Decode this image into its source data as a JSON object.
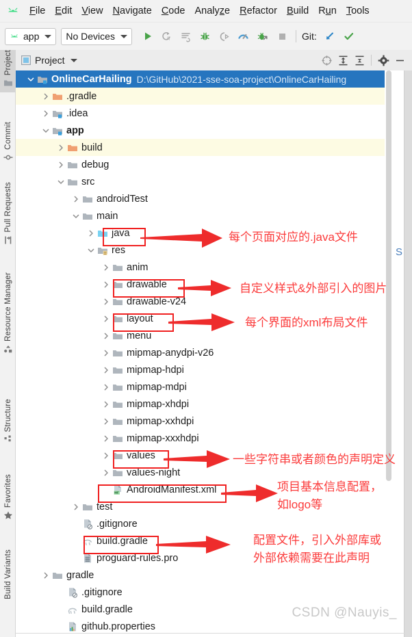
{
  "app": {
    "logo_icon": "android-logo-icon",
    "menu": [
      {
        "label": "File",
        "mnemonic": "F"
      },
      {
        "label": "Edit",
        "mnemonic": "E"
      },
      {
        "label": "View",
        "mnemonic": "V"
      },
      {
        "label": "Navigate",
        "mnemonic": "N"
      },
      {
        "label": "Code",
        "mnemonic": "C"
      },
      {
        "label": "Analyze",
        "mnemonic": "z"
      },
      {
        "label": "Refactor",
        "mnemonic": "R"
      },
      {
        "label": "Build",
        "mnemonic": "B"
      },
      {
        "label": "Run",
        "mnemonic": "u"
      },
      {
        "label": "Tools",
        "mnemonic": "T"
      }
    ]
  },
  "toolbar": {
    "run_config": "app",
    "device_selector": "No Devices",
    "git_label": "Git:",
    "icons": [
      "run-icon",
      "rerun-autotest-icon",
      "apply-changes-icon",
      "debug-icon",
      "attach-debugger-icon",
      "profiler-icon",
      "debug-native-icon",
      "stop-icon"
    ],
    "git_icons": [
      "update-project-icon",
      "commit-icon"
    ]
  },
  "left_strip": {
    "items": [
      {
        "label": "Project",
        "icon": "project-folder-icon",
        "active": true
      },
      {
        "label": "Commit",
        "icon": "commit-icon",
        "active": false
      },
      {
        "label": "Pull Requests",
        "icon": "pull-request-icon",
        "active": false
      },
      {
        "label": "Resource Manager",
        "icon": "resource-manager-icon",
        "active": false
      },
      {
        "label": "Structure",
        "icon": "structure-icon",
        "active": false
      },
      {
        "label": "Favorites",
        "icon": "star-icon",
        "active": false
      },
      {
        "label": "Build Variants",
        "icon": "build-variants-icon",
        "active": false
      }
    ]
  },
  "panel_header": {
    "title": "Project",
    "view_icon": "project-view-icon",
    "caret_icon": "chevron-down-icon",
    "icons": [
      "select-opened-file-icon",
      "expand-all-icon",
      "collapse-all-icon",
      "settings-gear-icon",
      "hide-panel-icon"
    ]
  },
  "tree": {
    "rows": [
      {
        "depth": 0,
        "label": "OnlineCarHailing",
        "path": "D:\\GitHub\\2021-sse-soa-project\\OnlineCarHailing",
        "icon": "module-folder-icon",
        "arrow": "expanded",
        "bold": true,
        "state": "selected"
      },
      {
        "depth": 1,
        "label": ".gradle",
        "icon": "excluded-folder-icon",
        "arrow": "collapsed",
        "bold": false,
        "state": "highlight"
      },
      {
        "depth": 1,
        "label": ".idea",
        "icon": "module-folder-icon",
        "arrow": "collapsed",
        "bold": false,
        "state": "normal"
      },
      {
        "depth": 1,
        "label": "app",
        "icon": "module-folder-icon",
        "arrow": "expanded",
        "bold": true,
        "state": "normal"
      },
      {
        "depth": 2,
        "label": "build",
        "icon": "excluded-folder-icon",
        "arrow": "collapsed",
        "bold": false,
        "state": "highlight"
      },
      {
        "depth": 2,
        "label": "debug",
        "icon": "folder-icon",
        "arrow": "collapsed",
        "bold": false,
        "state": "normal"
      },
      {
        "depth": 2,
        "label": "src",
        "icon": "folder-icon",
        "arrow": "expanded",
        "bold": false,
        "state": "normal"
      },
      {
        "depth": 3,
        "label": "androidTest",
        "icon": "folder-icon",
        "arrow": "collapsed",
        "bold": false,
        "state": "normal"
      },
      {
        "depth": 3,
        "label": "main",
        "icon": "folder-icon",
        "arrow": "expanded",
        "bold": false,
        "state": "normal"
      },
      {
        "depth": 4,
        "label": "java",
        "icon": "source-folder-icon",
        "arrow": "collapsed",
        "bold": false,
        "state": "normal"
      },
      {
        "depth": 4,
        "label": "res",
        "icon": "res-folder-icon",
        "arrow": "expanded",
        "bold": false,
        "state": "normal"
      },
      {
        "depth": 5,
        "label": "anim",
        "icon": "folder-icon",
        "arrow": "collapsed",
        "bold": false,
        "state": "normal"
      },
      {
        "depth": 5,
        "label": "drawable",
        "icon": "folder-icon",
        "arrow": "collapsed",
        "bold": false,
        "state": "normal"
      },
      {
        "depth": 5,
        "label": "drawable-v24",
        "icon": "folder-icon",
        "arrow": "collapsed",
        "bold": false,
        "state": "normal"
      },
      {
        "depth": 5,
        "label": "layout",
        "icon": "folder-icon",
        "arrow": "collapsed",
        "bold": false,
        "state": "normal"
      },
      {
        "depth": 5,
        "label": "menu",
        "icon": "folder-icon",
        "arrow": "collapsed",
        "bold": false,
        "state": "normal"
      },
      {
        "depth": 5,
        "label": "mipmap-anydpi-v26",
        "icon": "folder-icon",
        "arrow": "collapsed",
        "bold": false,
        "state": "normal"
      },
      {
        "depth": 5,
        "label": "mipmap-hdpi",
        "icon": "folder-icon",
        "arrow": "collapsed",
        "bold": false,
        "state": "normal"
      },
      {
        "depth": 5,
        "label": "mipmap-mdpi",
        "icon": "folder-icon",
        "arrow": "collapsed",
        "bold": false,
        "state": "normal"
      },
      {
        "depth": 5,
        "label": "mipmap-xhdpi",
        "icon": "folder-icon",
        "arrow": "collapsed",
        "bold": false,
        "state": "normal"
      },
      {
        "depth": 5,
        "label": "mipmap-xxhdpi",
        "icon": "folder-icon",
        "arrow": "collapsed",
        "bold": false,
        "state": "normal"
      },
      {
        "depth": 5,
        "label": "mipmap-xxxhdpi",
        "icon": "folder-icon",
        "arrow": "collapsed",
        "bold": false,
        "state": "normal"
      },
      {
        "depth": 5,
        "label": "values",
        "icon": "folder-icon",
        "arrow": "collapsed",
        "bold": false,
        "state": "normal"
      },
      {
        "depth": 5,
        "label": "values-night",
        "icon": "folder-icon",
        "arrow": "collapsed",
        "bold": false,
        "state": "normal"
      },
      {
        "depth": 5,
        "label": "AndroidManifest.xml",
        "icon": "manifest-file-icon",
        "arrow": "none",
        "bold": false,
        "state": "normal"
      },
      {
        "depth": 3,
        "label": "test",
        "icon": "folder-icon",
        "arrow": "collapsed",
        "bold": false,
        "state": "normal"
      },
      {
        "depth": 3,
        "label": ".gitignore",
        "icon": "gitignore-file-icon",
        "arrow": "none",
        "bold": false,
        "state": "normal"
      },
      {
        "depth": 3,
        "label": "build.gradle",
        "icon": "gradle-file-icon",
        "arrow": "none",
        "bold": false,
        "state": "normal"
      },
      {
        "depth": 3,
        "label": "proguard-rules.pro",
        "icon": "text-file-icon",
        "arrow": "none",
        "bold": false,
        "state": "normal"
      },
      {
        "depth": 1,
        "label": "gradle",
        "icon": "folder-icon",
        "arrow": "collapsed",
        "bold": false,
        "state": "normal"
      },
      {
        "depth": 2,
        "label": ".gitignore",
        "icon": "gitignore-file-icon",
        "arrow": "none",
        "bold": false,
        "state": "normal"
      },
      {
        "depth": 2,
        "label": "build.gradle",
        "icon": "gradle-file-icon",
        "arrow": "none",
        "bold": false,
        "state": "normal"
      },
      {
        "depth": 2,
        "label": "github.properties",
        "icon": "properties-file-icon",
        "arrow": "none",
        "bold": false,
        "state": "normal"
      }
    ]
  },
  "annotations": {
    "color": "#fb3b3b",
    "notes": [
      {
        "id": "java",
        "text": "每个页面对应的.java文件"
      },
      {
        "id": "drawable",
        "text": "自定义样式&外部引入的图片"
      },
      {
        "id": "layout",
        "text": "每个界面的xml布局文件"
      },
      {
        "id": "values",
        "text": "一些字符串或者颜色的声明定义"
      },
      {
        "id": "manifest_l1",
        "text": "项目基本信息配置，"
      },
      {
        "id": "manifest_l2",
        "text": "如logo等"
      },
      {
        "id": "gradle_l1",
        "text": "配置文件，引入外部库或"
      },
      {
        "id": "gradle_l2",
        "text": "外部依赖需要在此声明"
      }
    ],
    "boxed_rows": [
      "java",
      "drawable",
      "layout",
      "values",
      "AndroidManifest.xml",
      "build.gradle"
    ]
  },
  "editor_sliver": {
    "text": "S"
  },
  "watermark": {
    "text": "CSDN @Nauyis_"
  }
}
